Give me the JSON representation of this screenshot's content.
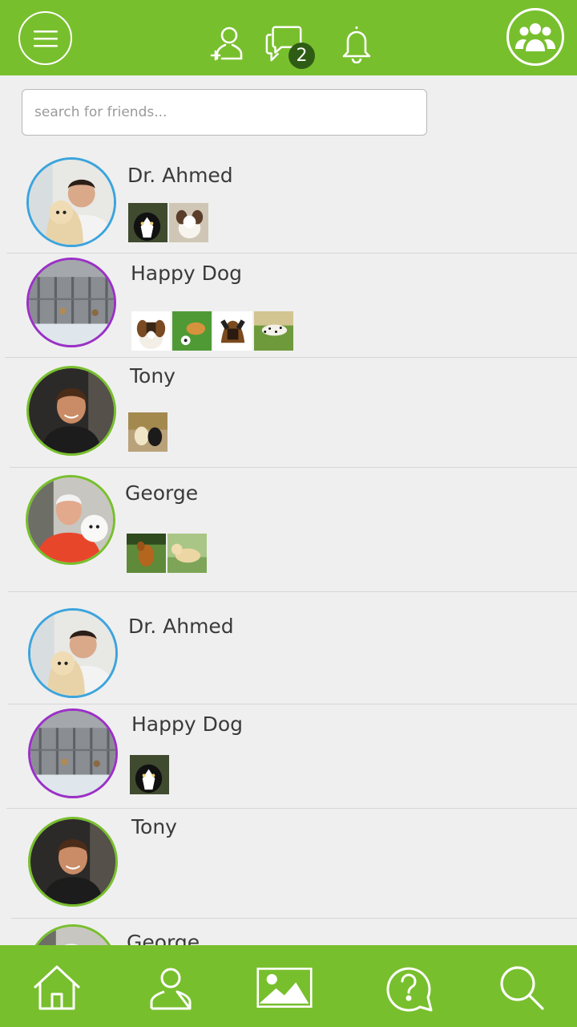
{
  "header": {
    "menu_icon": "hamburger-menu-icon",
    "add_friend_icon": "add-user-icon",
    "messages_icon": "chat-bubbles-icon",
    "messages_badge": "2",
    "notifications_icon": "bell-icon",
    "groups_icon": "group-icon"
  },
  "search": {
    "placeholder": "search for friends..."
  },
  "colors": {
    "brand_green": "#78bf2d",
    "badge_bg": "#2f5c15",
    "ring_blue": "#3ba4dd",
    "ring_purple": "#9b30c7",
    "ring_green": "#78bf2d"
  },
  "friends": [
    {
      "name": "Dr. Ahmed",
      "ring": "blue",
      "pets": [
        "border-collie",
        "papillon"
      ]
    },
    {
      "name": "Happy Dog",
      "ring": "purple",
      "pets": [
        "beagle",
        "puppy-with-ball",
        "german-shepherd",
        "dalmatian"
      ]
    },
    {
      "name": "Tony",
      "ring": "green",
      "pets": [
        "two-labradors"
      ]
    },
    {
      "name": "George",
      "ring": "green",
      "pets": [
        "golden-retriever-running",
        "yellow-labrador"
      ]
    },
    {
      "name": "Dr. Ahmed",
      "ring": "blue",
      "pets": []
    },
    {
      "name": "Happy Dog",
      "ring": "purple",
      "pets": [
        "border-collie"
      ]
    },
    {
      "name": "Tony",
      "ring": "green",
      "pets": []
    },
    {
      "name": "George",
      "ring": "green",
      "pets": []
    }
  ],
  "bottom_nav": [
    "home-icon",
    "profile-icon",
    "gallery-icon",
    "help-icon",
    "search-icon"
  ]
}
